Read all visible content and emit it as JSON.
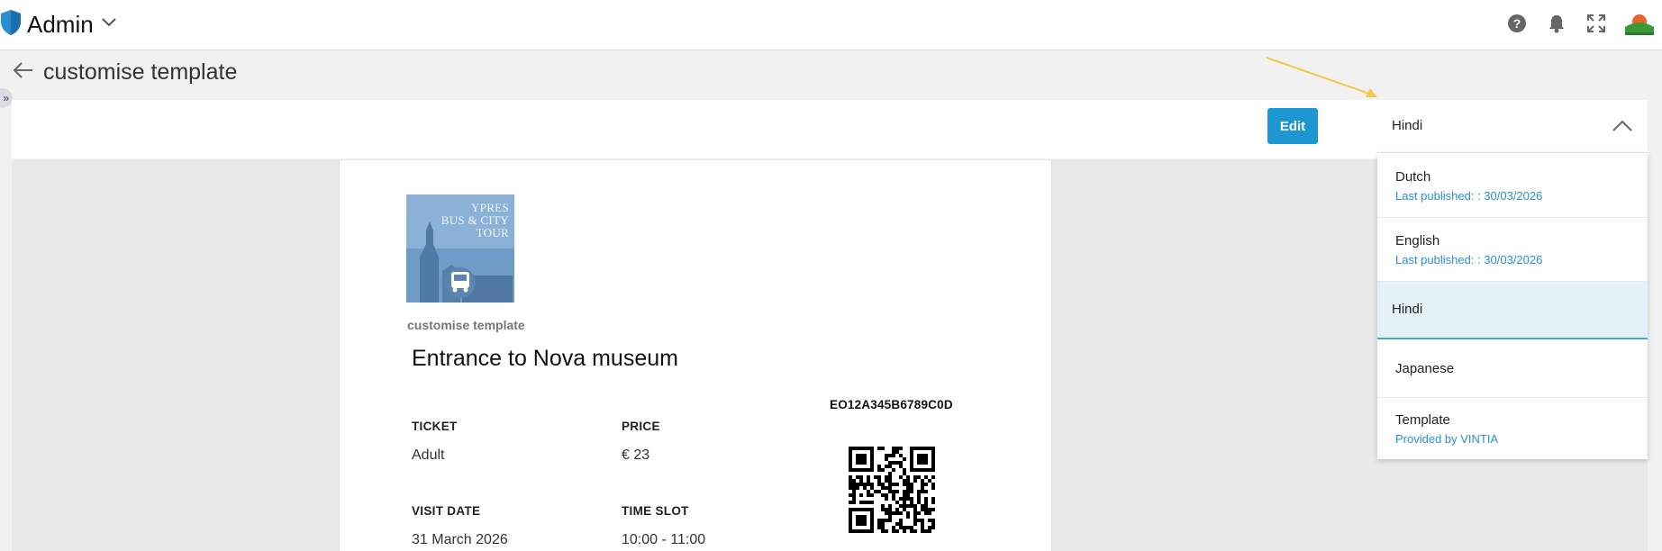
{
  "app": {
    "name": "Admin"
  },
  "header_icons": [
    "help-icon",
    "bell-icon",
    "fullscreen-icon",
    "avatar"
  ],
  "page": {
    "title": "customise template"
  },
  "toolbar": {
    "edit_label": "Edit"
  },
  "language_select": {
    "selected": "Hindi",
    "options": [
      {
        "name": "Dutch",
        "meta": "Last published: : 30/03/2026"
      },
      {
        "name": "English",
        "meta": "Last published: : 30/03/2026"
      },
      {
        "name": "Hindi",
        "meta": ""
      },
      {
        "name": "Japanese",
        "meta": ""
      },
      {
        "name": "Template",
        "meta": "Provided by VINTIA"
      }
    ]
  },
  "ticket": {
    "logo_text": [
      "YPRES",
      "BUS & CITY",
      "TOUR"
    ],
    "subtitle": "customise template",
    "title": "Entrance to Nova museum",
    "code": "EO12A345B6789C0D",
    "fields": [
      {
        "label": "TICKET",
        "value": "Adult"
      },
      {
        "label": "PRICE",
        "value": "€ 23"
      },
      {
        "label": "VISIT DATE",
        "value": "31 March 2026"
      },
      {
        "label": "TIME SLOT",
        "value": "10:00 - 11:00"
      }
    ]
  },
  "colors": {
    "accent": "#1e96d2",
    "link": "#2a8fd0",
    "active_bg": "#e5f1f8",
    "arrow": "#f2c94c"
  }
}
